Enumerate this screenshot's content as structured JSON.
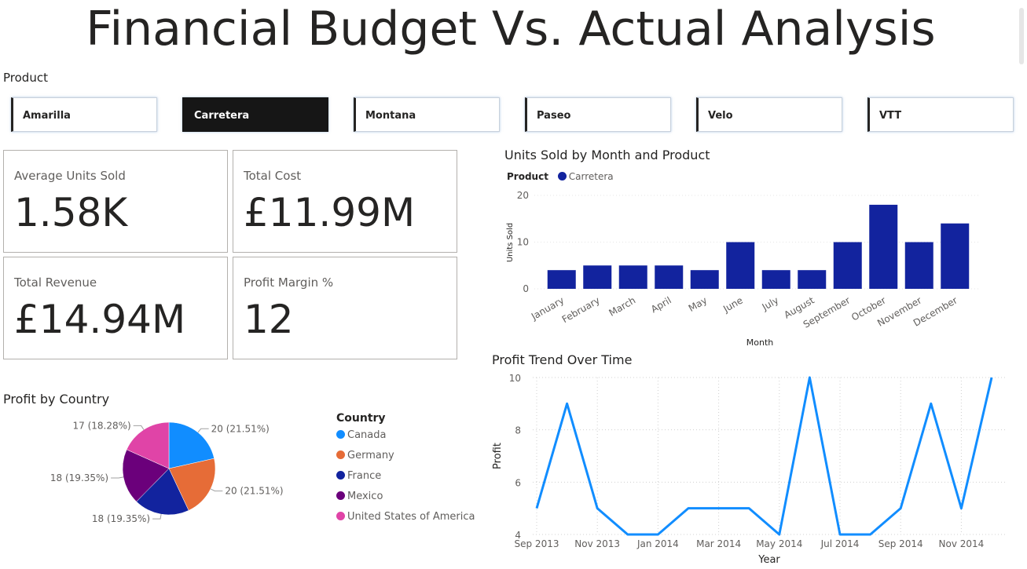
{
  "page": {
    "title": "Financial Budget Vs. Actual Analysis"
  },
  "slicer": {
    "label": "Product",
    "items": [
      {
        "label": "Amarilla",
        "selected": false
      },
      {
        "label": "Carretera",
        "selected": true
      },
      {
        "label": "Montana",
        "selected": false
      },
      {
        "label": "Paseo",
        "selected": false
      },
      {
        "label": "Velo",
        "selected": false
      },
      {
        "label": "VTT",
        "selected": false
      }
    ]
  },
  "kpis": [
    {
      "label": "Average Units Sold",
      "value": "1.58K"
    },
    {
      "label": "Total Cost",
      "value": "£11.99M"
    },
    {
      "label": "Total Revenue",
      "value": "£14.94M"
    },
    {
      "label": "Profit Margin %",
      "value": "12"
    }
  ],
  "colors": {
    "bar": "#12239e",
    "line": "#118dff",
    "canada": "#118dff",
    "germany": "#e66c37",
    "france": "#12239e",
    "mexico": "#6b007b",
    "usa": "#e044a7"
  },
  "chart_data": [
    {
      "type": "bar",
      "title": "Units Sold by Month and Product",
      "legend_title": "Product",
      "categories": [
        "January",
        "February",
        "March",
        "April",
        "May",
        "June",
        "July",
        "August",
        "September",
        "October",
        "November",
        "December"
      ],
      "series": [
        {
          "name": "Carretera",
          "values": [
            4,
            5,
            5,
            5,
            4,
            10,
            4,
            4,
            10,
            18,
            10,
            14
          ]
        }
      ],
      "xlabel": "Month",
      "ylabel": "Units Sold",
      "yticks": [
        "0",
        "10",
        "20"
      ],
      "ylim": [
        0,
        20
      ]
    },
    {
      "type": "line",
      "title": "Profit Trend Over Time",
      "xlabel": "Year",
      "ylabel": "Profit",
      "x": [
        "Sep 2013",
        "Oct 2013",
        "Nov 2013",
        "Dec 2013",
        "Jan 2014",
        "Feb 2014",
        "Mar 2014",
        "Apr 2014",
        "May 2014",
        "Jun 2014",
        "Jul 2014",
        "Aug 2014",
        "Sep 2014",
        "Oct 2014",
        "Nov 2014",
        "Dec 2014"
      ],
      "xticks": [
        "Sep 2013",
        "Nov 2013",
        "Jan 2014",
        "Mar 2014",
        "May 2014",
        "Jul 2014",
        "Sep 2014",
        "Nov 2014"
      ],
      "values": [
        5,
        9,
        5,
        4,
        4,
        5,
        5,
        5,
        4,
        10,
        4,
        4,
        5,
        9,
        5,
        10
      ],
      "yticks": [
        "4",
        "6",
        "8",
        "10"
      ],
      "ylim": [
        4,
        10
      ],
      "grid": true
    },
    {
      "type": "pie",
      "title": "Profit by Country",
      "legend_title": "Country",
      "slices": [
        {
          "name": "Canada",
          "value": 20,
          "label": "20 (21.51%)"
        },
        {
          "name": "Germany",
          "value": 20,
          "label": "20 (21.51%)"
        },
        {
          "name": "France",
          "value": 18,
          "label": "18 (19.35%)"
        },
        {
          "name": "Mexico",
          "value": 18,
          "label": "18 (19.35%)"
        },
        {
          "name": "United States of America",
          "value": 17,
          "label": "17 (18.28%)"
        }
      ]
    }
  ]
}
